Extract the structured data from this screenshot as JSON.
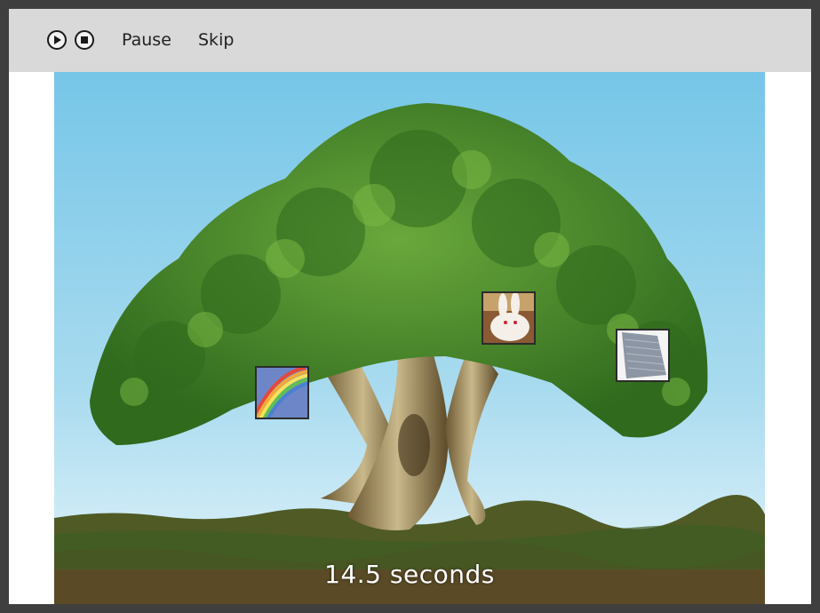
{
  "toolbar": {
    "play_icon": "play-circle-icon",
    "stop_icon": "stop-circle-icon",
    "pause_label": "Pause",
    "skip_label": "Skip"
  },
  "scene": {
    "background_icon": "bonsai-tree-scene",
    "images": [
      {
        "name": "rainbow",
        "icon": "rainbow-thumbnail"
      },
      {
        "name": "rabbit",
        "icon": "rabbit-thumbnail"
      },
      {
        "name": "fabric",
        "icon": "gray-fabric-thumbnail"
      }
    ]
  },
  "timer": {
    "text": "14.5 seconds"
  },
  "colors": {
    "toolbar_bg": "#d9d9d9",
    "frame": "#3f3f3f",
    "sky_top": "#7cc7e6",
    "sky_bottom": "#dff1f8",
    "foliage": "#4f8f2c",
    "ground": "#5a4a26"
  }
}
